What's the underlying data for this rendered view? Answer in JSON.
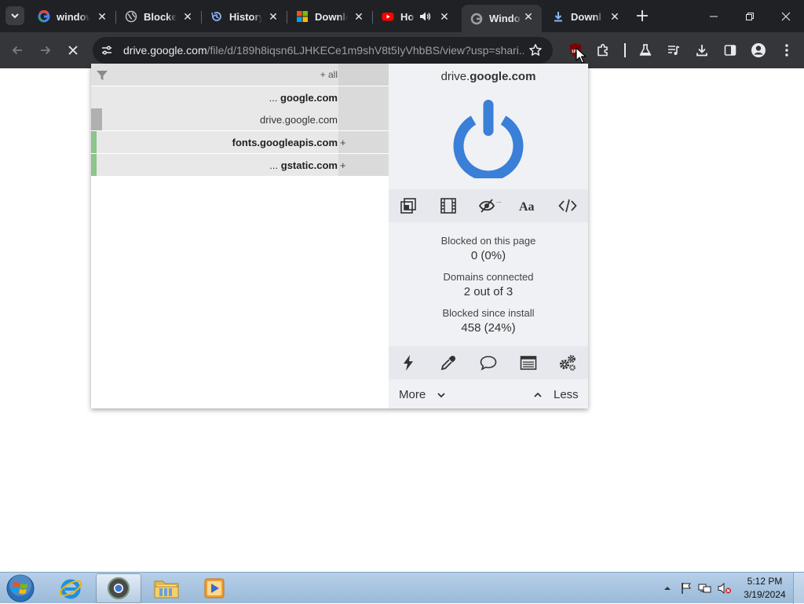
{
  "browser": {
    "tabs": [
      {
        "title": "window",
        "icon": "google-icon",
        "active": false
      },
      {
        "title": "Blocked",
        "icon": "globe-icon",
        "active": false
      },
      {
        "title": "History",
        "icon": "history-icon",
        "active": false
      },
      {
        "title": "Downlo",
        "icon": "microsoft-icon",
        "active": false
      },
      {
        "title": "Ho",
        "icon": "youtube-icon",
        "active": false,
        "audio": true
      },
      {
        "title": "Windo",
        "icon": "google-icon",
        "active": true
      },
      {
        "title": "Downl",
        "icon": "download-icon",
        "active": false
      }
    ],
    "omnibox": {
      "host": "drive.google.com",
      "path": "/file/d/189h8iqsn6LJHKECe1m9shV8t5IyVhbBS/view?usp=shari..."
    }
  },
  "popup": {
    "firewall": {
      "all_label": "+ all",
      "rows": [
        {
          "prefix": "... ",
          "domain": "google.com",
          "bold": true,
          "bar": "",
          "plus": ""
        },
        {
          "prefix": "",
          "domain": "drive.google.com",
          "bold": false,
          "bar": "#b0b0b0",
          "plus": ""
        },
        {
          "prefix": "",
          "domain": "fonts.googleapis.com",
          "bold": true,
          "bar": "#8dc48a",
          "plus": "+"
        },
        {
          "prefix": "... ",
          "domain": "gstatic.com",
          "bold": true,
          "bar": "#8dc48a",
          "plus": "+"
        }
      ]
    },
    "hostname": {
      "sub": "drive.",
      "main": "google.com"
    },
    "power_color": "#3a7fd8",
    "stats": {
      "blocked_page_label": "Blocked on this page",
      "blocked_page_value": "0 (0%)",
      "domains_label": "Domains connected",
      "domains_value": "2 out of 3",
      "blocked_install_label": "Blocked since install",
      "blocked_install_value": "458 (24%)"
    },
    "more_label": "More",
    "less_label": "Less"
  },
  "taskbar": {
    "time": "5:12 PM",
    "date": "3/19/2024"
  }
}
